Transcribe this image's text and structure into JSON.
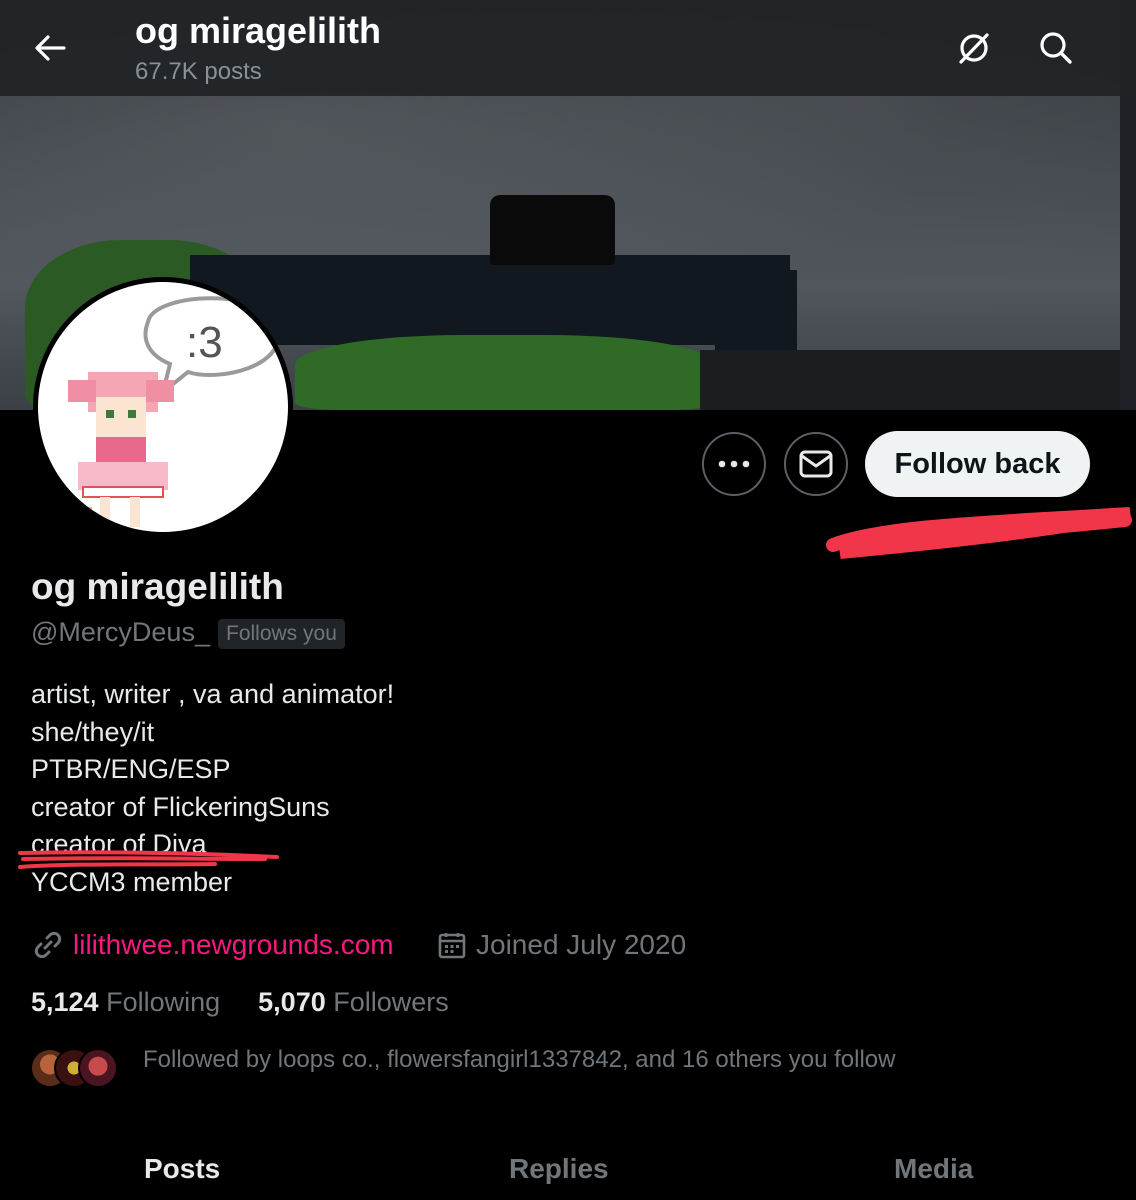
{
  "header": {
    "title": "og miragelilith",
    "post_count": "67.7K posts"
  },
  "actions": {
    "follow_back_label": "Follow back"
  },
  "profile": {
    "display_name": "og miragelilith",
    "handle": "@MercyDeus_",
    "follows_you_badge": "Follows you",
    "avatar_speech_bubble": ":3",
    "bio_lines": [
      "artist, writer , va and animator!",
      "she/they/it",
      "PTBR/ENG/ESP",
      "creator of FlickeringSuns",
      "creator of Diva",
      "YCCM3 member"
    ],
    "website": "lilithwee.newgrounds.com",
    "joined": "Joined July 2020",
    "following_count": "5,124",
    "following_label": "Following",
    "followers_count": "5,070",
    "followers_label": "Followers",
    "followed_by_text": "Followed by loops co., flowersfangirl1337842, and 16 others you follow"
  },
  "tabs": [
    {
      "label": "Posts",
      "active": true
    },
    {
      "label": "Replies",
      "active": false
    },
    {
      "label": "Media",
      "active": false
    }
  ],
  "colors": {
    "link": "#f91880",
    "annotation_scribble": "#f2364a",
    "secondary_text": "#71767b"
  },
  "icons": {
    "back": "arrow-left-icon",
    "header_action": "grok-slash-icon",
    "search": "search-icon",
    "more": "more-dots-icon",
    "message": "envelope-icon",
    "link": "link-icon",
    "calendar": "calendar-icon"
  }
}
